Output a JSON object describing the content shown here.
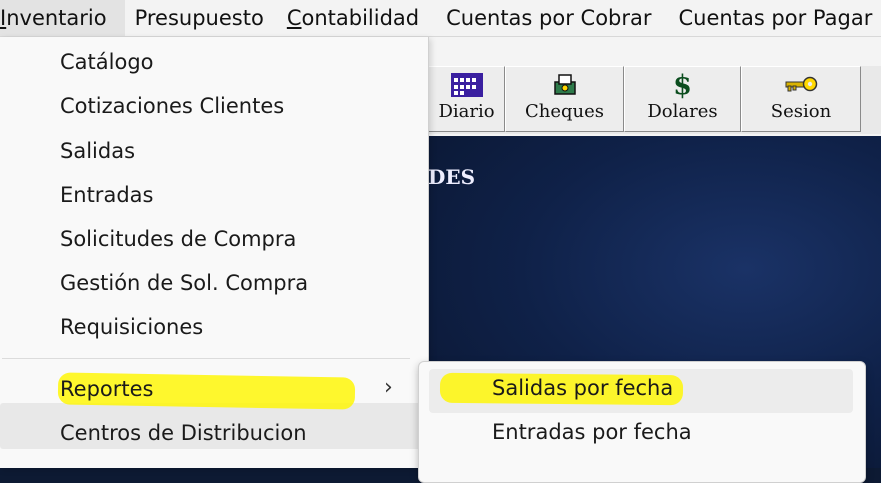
{
  "menubar": {
    "items": [
      {
        "label": "Inventario"
      },
      {
        "label": "Presupuesto"
      },
      {
        "label": "Contabilidad"
      },
      {
        "label": "Cuentas por Cobrar"
      },
      {
        "label": "Cuentas por Pagar"
      }
    ]
  },
  "toolbar": {
    "buttons": [
      {
        "label": "Diario",
        "icon": "calendar-icon"
      },
      {
        "label": "Cheques",
        "icon": "printer-icon"
      },
      {
        "label": "Dolares",
        "icon": "dollar-icon"
      },
      {
        "label": "Sesion",
        "icon": "key-icon"
      }
    ]
  },
  "panel": {
    "title_fragment": "DES"
  },
  "inventario_menu": {
    "items": [
      {
        "label": "Catálogo"
      },
      {
        "label": "Cotizaciones Clientes"
      },
      {
        "label": "Salidas"
      },
      {
        "label": "Entradas"
      },
      {
        "label": "Solicitudes de Compra"
      },
      {
        "label": "Gestión de Sol. Compra"
      },
      {
        "label": "Requisiciones"
      },
      {
        "label": "Reportes"
      },
      {
        "label": "Centros de Distribucion"
      }
    ],
    "submenu_chevron": "›"
  },
  "reportes_submenu": {
    "items": [
      {
        "label": "Salidas por fecha"
      },
      {
        "label": "Entradas por fecha"
      }
    ]
  },
  "colors": {
    "highlighter": "#fff700",
    "panel_bg": "#0f2148"
  }
}
